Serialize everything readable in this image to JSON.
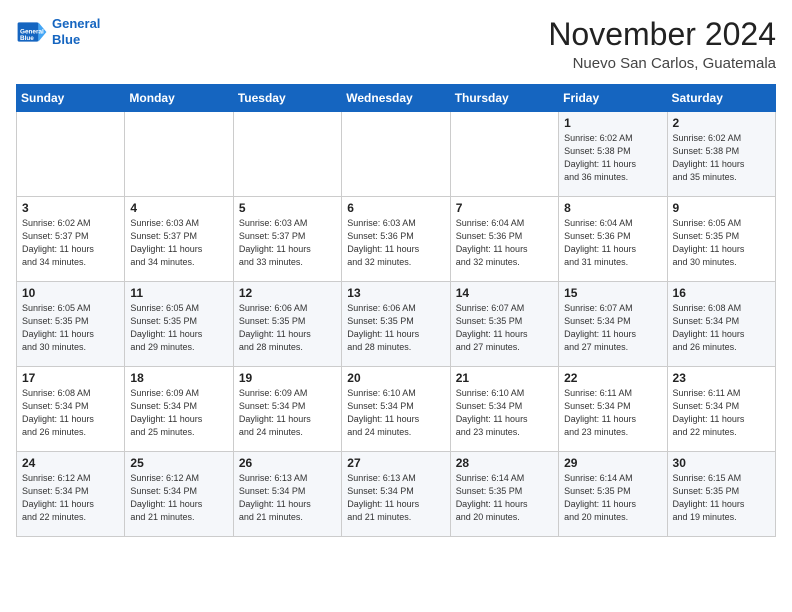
{
  "header": {
    "logo_line1": "General",
    "logo_line2": "Blue",
    "month": "November 2024",
    "location": "Nuevo San Carlos, Guatemala"
  },
  "weekdays": [
    "Sunday",
    "Monday",
    "Tuesday",
    "Wednesday",
    "Thursday",
    "Friday",
    "Saturday"
  ],
  "weeks": [
    [
      {
        "day": "",
        "info": ""
      },
      {
        "day": "",
        "info": ""
      },
      {
        "day": "",
        "info": ""
      },
      {
        "day": "",
        "info": ""
      },
      {
        "day": "",
        "info": ""
      },
      {
        "day": "1",
        "info": "Sunrise: 6:02 AM\nSunset: 5:38 PM\nDaylight: 11 hours\nand 36 minutes."
      },
      {
        "day": "2",
        "info": "Sunrise: 6:02 AM\nSunset: 5:38 PM\nDaylight: 11 hours\nand 35 minutes."
      }
    ],
    [
      {
        "day": "3",
        "info": "Sunrise: 6:02 AM\nSunset: 5:37 PM\nDaylight: 11 hours\nand 34 minutes."
      },
      {
        "day": "4",
        "info": "Sunrise: 6:03 AM\nSunset: 5:37 PM\nDaylight: 11 hours\nand 34 minutes."
      },
      {
        "day": "5",
        "info": "Sunrise: 6:03 AM\nSunset: 5:37 PM\nDaylight: 11 hours\nand 33 minutes."
      },
      {
        "day": "6",
        "info": "Sunrise: 6:03 AM\nSunset: 5:36 PM\nDaylight: 11 hours\nand 32 minutes."
      },
      {
        "day": "7",
        "info": "Sunrise: 6:04 AM\nSunset: 5:36 PM\nDaylight: 11 hours\nand 32 minutes."
      },
      {
        "day": "8",
        "info": "Sunrise: 6:04 AM\nSunset: 5:36 PM\nDaylight: 11 hours\nand 31 minutes."
      },
      {
        "day": "9",
        "info": "Sunrise: 6:05 AM\nSunset: 5:35 PM\nDaylight: 11 hours\nand 30 minutes."
      }
    ],
    [
      {
        "day": "10",
        "info": "Sunrise: 6:05 AM\nSunset: 5:35 PM\nDaylight: 11 hours\nand 30 minutes."
      },
      {
        "day": "11",
        "info": "Sunrise: 6:05 AM\nSunset: 5:35 PM\nDaylight: 11 hours\nand 29 minutes."
      },
      {
        "day": "12",
        "info": "Sunrise: 6:06 AM\nSunset: 5:35 PM\nDaylight: 11 hours\nand 28 minutes."
      },
      {
        "day": "13",
        "info": "Sunrise: 6:06 AM\nSunset: 5:35 PM\nDaylight: 11 hours\nand 28 minutes."
      },
      {
        "day": "14",
        "info": "Sunrise: 6:07 AM\nSunset: 5:35 PM\nDaylight: 11 hours\nand 27 minutes."
      },
      {
        "day": "15",
        "info": "Sunrise: 6:07 AM\nSunset: 5:34 PM\nDaylight: 11 hours\nand 27 minutes."
      },
      {
        "day": "16",
        "info": "Sunrise: 6:08 AM\nSunset: 5:34 PM\nDaylight: 11 hours\nand 26 minutes."
      }
    ],
    [
      {
        "day": "17",
        "info": "Sunrise: 6:08 AM\nSunset: 5:34 PM\nDaylight: 11 hours\nand 26 minutes."
      },
      {
        "day": "18",
        "info": "Sunrise: 6:09 AM\nSunset: 5:34 PM\nDaylight: 11 hours\nand 25 minutes."
      },
      {
        "day": "19",
        "info": "Sunrise: 6:09 AM\nSunset: 5:34 PM\nDaylight: 11 hours\nand 24 minutes."
      },
      {
        "day": "20",
        "info": "Sunrise: 6:10 AM\nSunset: 5:34 PM\nDaylight: 11 hours\nand 24 minutes."
      },
      {
        "day": "21",
        "info": "Sunrise: 6:10 AM\nSunset: 5:34 PM\nDaylight: 11 hours\nand 23 minutes."
      },
      {
        "day": "22",
        "info": "Sunrise: 6:11 AM\nSunset: 5:34 PM\nDaylight: 11 hours\nand 23 minutes."
      },
      {
        "day": "23",
        "info": "Sunrise: 6:11 AM\nSunset: 5:34 PM\nDaylight: 11 hours\nand 22 minutes."
      }
    ],
    [
      {
        "day": "24",
        "info": "Sunrise: 6:12 AM\nSunset: 5:34 PM\nDaylight: 11 hours\nand 22 minutes."
      },
      {
        "day": "25",
        "info": "Sunrise: 6:12 AM\nSunset: 5:34 PM\nDaylight: 11 hours\nand 21 minutes."
      },
      {
        "day": "26",
        "info": "Sunrise: 6:13 AM\nSunset: 5:34 PM\nDaylight: 11 hours\nand 21 minutes."
      },
      {
        "day": "27",
        "info": "Sunrise: 6:13 AM\nSunset: 5:34 PM\nDaylight: 11 hours\nand 21 minutes."
      },
      {
        "day": "28",
        "info": "Sunrise: 6:14 AM\nSunset: 5:35 PM\nDaylight: 11 hours\nand 20 minutes."
      },
      {
        "day": "29",
        "info": "Sunrise: 6:14 AM\nSunset: 5:35 PM\nDaylight: 11 hours\nand 20 minutes."
      },
      {
        "day": "30",
        "info": "Sunrise: 6:15 AM\nSunset: 5:35 PM\nDaylight: 11 hours\nand 19 minutes."
      }
    ]
  ]
}
